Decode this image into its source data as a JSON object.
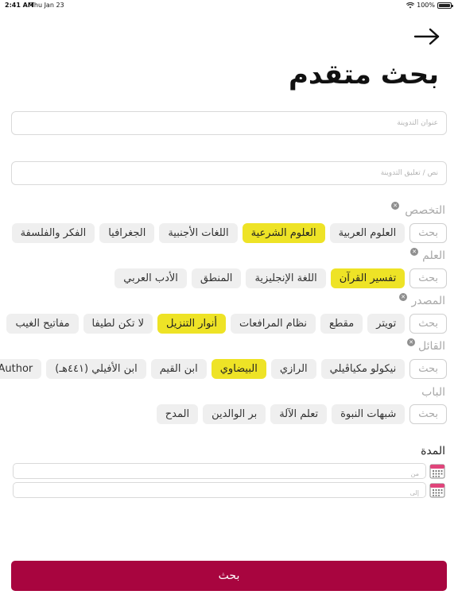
{
  "status_bar": {
    "time": "2:41 AM",
    "date": "Thu Jan 23",
    "battery": "100%"
  },
  "page_title": "بحث متقدم",
  "fields": {
    "blog_title_placeholder": "عنوان التدوينة",
    "blog_text_placeholder": "نص / تعليق التدوينة"
  },
  "sections": {
    "specialization": {
      "label": "التخصص",
      "search_label": "بحث",
      "chips": [
        "العلوم العربية",
        "العلوم الشرعية",
        "اللغات الأجنبية",
        "الجغرافيا",
        "الفكر والفلسفة"
      ]
    },
    "science": {
      "label": "العلم",
      "search_label": "بحث",
      "chips": [
        "تفسير القرآن",
        "اللغة الإنجليزية",
        "المنطق",
        "الأدب العربي"
      ]
    },
    "source": {
      "label": "المصدر",
      "search_label": "بحث",
      "chips": [
        "تويتر",
        "مقطع",
        "نظام المرافعات",
        "أنوار التنزيل",
        "لا تكن لطيفا",
        "مفاتيح الغيب"
      ]
    },
    "speaker": {
      "label": "القائل",
      "search_label": "بحث",
      "chips": [
        "نيكولو مكياڤيلي",
        "الرازي",
        "البيضاوي",
        "ابن القيم",
        "ابن الأفيلي (٤٤١هـ)",
        "Author"
      ]
    },
    "chapter": {
      "label": "الباب",
      "search_label": "بحث",
      "chips": [
        "شبهات النبوة",
        "تعلم الآلة",
        "بر الوالدين",
        "المدح"
      ]
    }
  },
  "duration": {
    "label": "المدة",
    "from_placeholder": "من",
    "to_placeholder": "إلى"
  },
  "submit_label": "بحث",
  "colors": {
    "accent": "#a8053f",
    "selected_chip": "#eee326",
    "chip_bg": "#efefef"
  }
}
